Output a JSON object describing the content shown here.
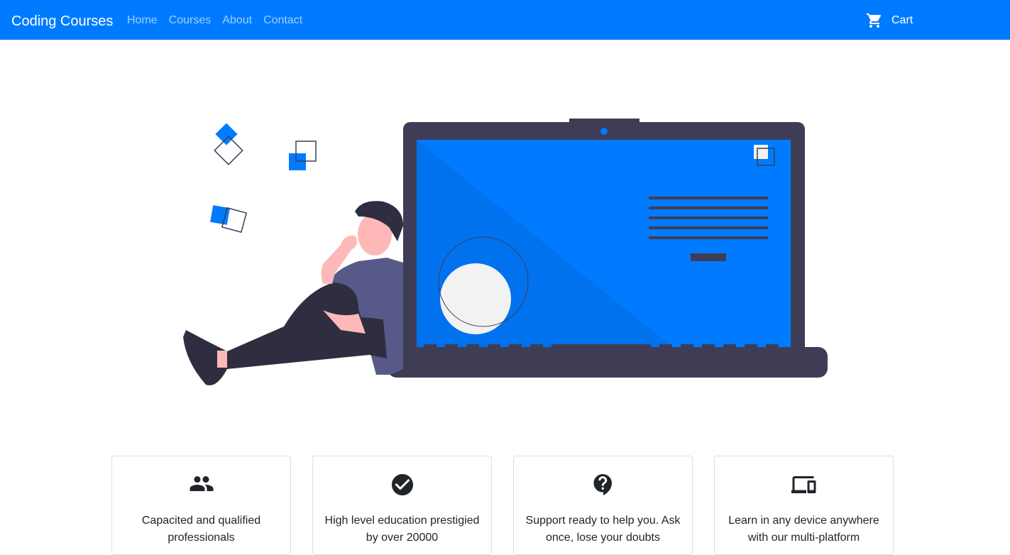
{
  "navbar": {
    "brand": "Coding Courses",
    "links": [
      "Home",
      "Courses",
      "About",
      "Contact"
    ],
    "cart_label": "Cart"
  },
  "colors": {
    "primary": "#007bff",
    "dark": "#3f3d56",
    "skin": "#ffb8b8",
    "shirt": "#575a89",
    "pants": "#2f2e41"
  },
  "hero": {
    "illustration": "person-leaning-on-laptop"
  },
  "features": [
    {
      "icon": "people-icon",
      "text": "Capacited and qualified professionals"
    },
    {
      "icon": "check-circle-icon",
      "text": "High level education prestigied by over 20000"
    },
    {
      "icon": "help-bubble-icon",
      "text": "Support ready to help you. Ask once, lose your doubts"
    },
    {
      "icon": "devices-icon",
      "text": "Learn in any device anywhere with our multi-platform"
    }
  ]
}
